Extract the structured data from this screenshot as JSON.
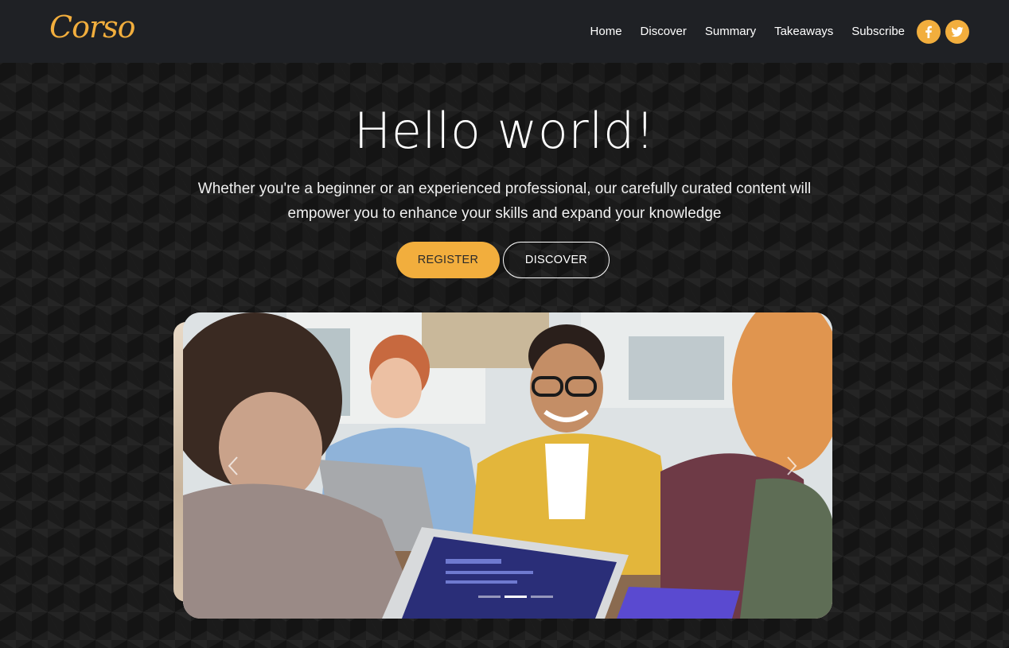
{
  "brand": {
    "name": "Corso"
  },
  "nav": {
    "links": [
      "Home",
      "Discover",
      "Summary",
      "Takeaways",
      "Subscribe"
    ],
    "social": [
      "facebook-icon",
      "twitter-icon"
    ]
  },
  "hero": {
    "title": "Hello world!",
    "subtitle": "Whether you're a beginner or an experienced professional, our carefully curated content will empower you to enhance your skills and expand your knowledge",
    "register_label": "REGISTER",
    "discover_label": "DISCOVER"
  },
  "carousel": {
    "slide_count": 3,
    "active_index": 1
  },
  "colors": {
    "accent": "#f2ae3d",
    "navbar_bg": "#1f2125",
    "page_bg": "#141414"
  }
}
